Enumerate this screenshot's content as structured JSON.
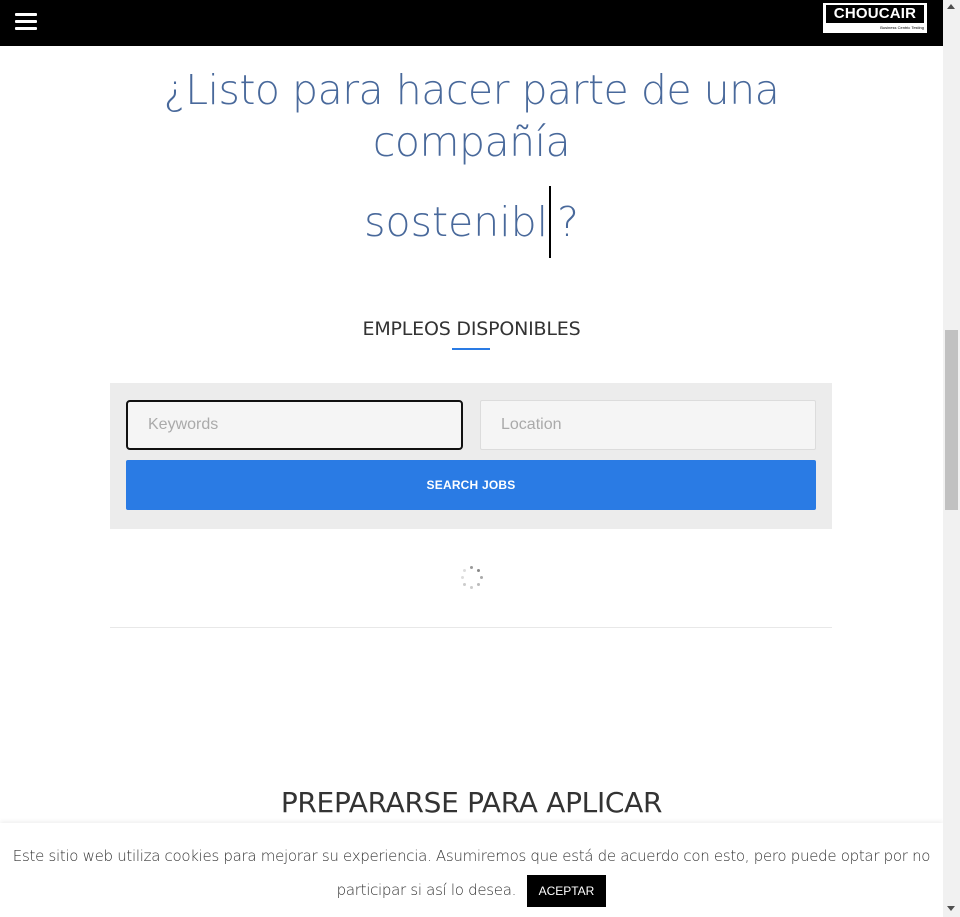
{
  "header": {
    "menu_icon": "hamburger-menu-icon",
    "logo_text": "CHOUCAIR",
    "logo_tagline": "Business Centric Testing"
  },
  "hero": {
    "line1": "¿Listo para hacer parte de una compañía",
    "line2_typed": "sostenibl",
    "line2_end": "?"
  },
  "jobs": {
    "title": "EMPLEOS DISPONIBLES",
    "keywords_placeholder": "Keywords",
    "location_placeholder": "Location",
    "search_label": "SEARCH JOBS",
    "accent_color": "#2a7be4",
    "loading_icon": "spinner-icon"
  },
  "prepare": {
    "title": "PREPARARSE PARA APLICAR"
  },
  "cookie": {
    "text": "Este sitio web utiliza cookies para mejorar su experiencia. Asumiremos que está de acuerdo con esto, pero puede optar por no participar si así lo desea.",
    "accept_label": "ACEPTAR"
  },
  "colors": {
    "headline": "#49699b",
    "topbar": "#000000",
    "panel": "#ececec"
  }
}
